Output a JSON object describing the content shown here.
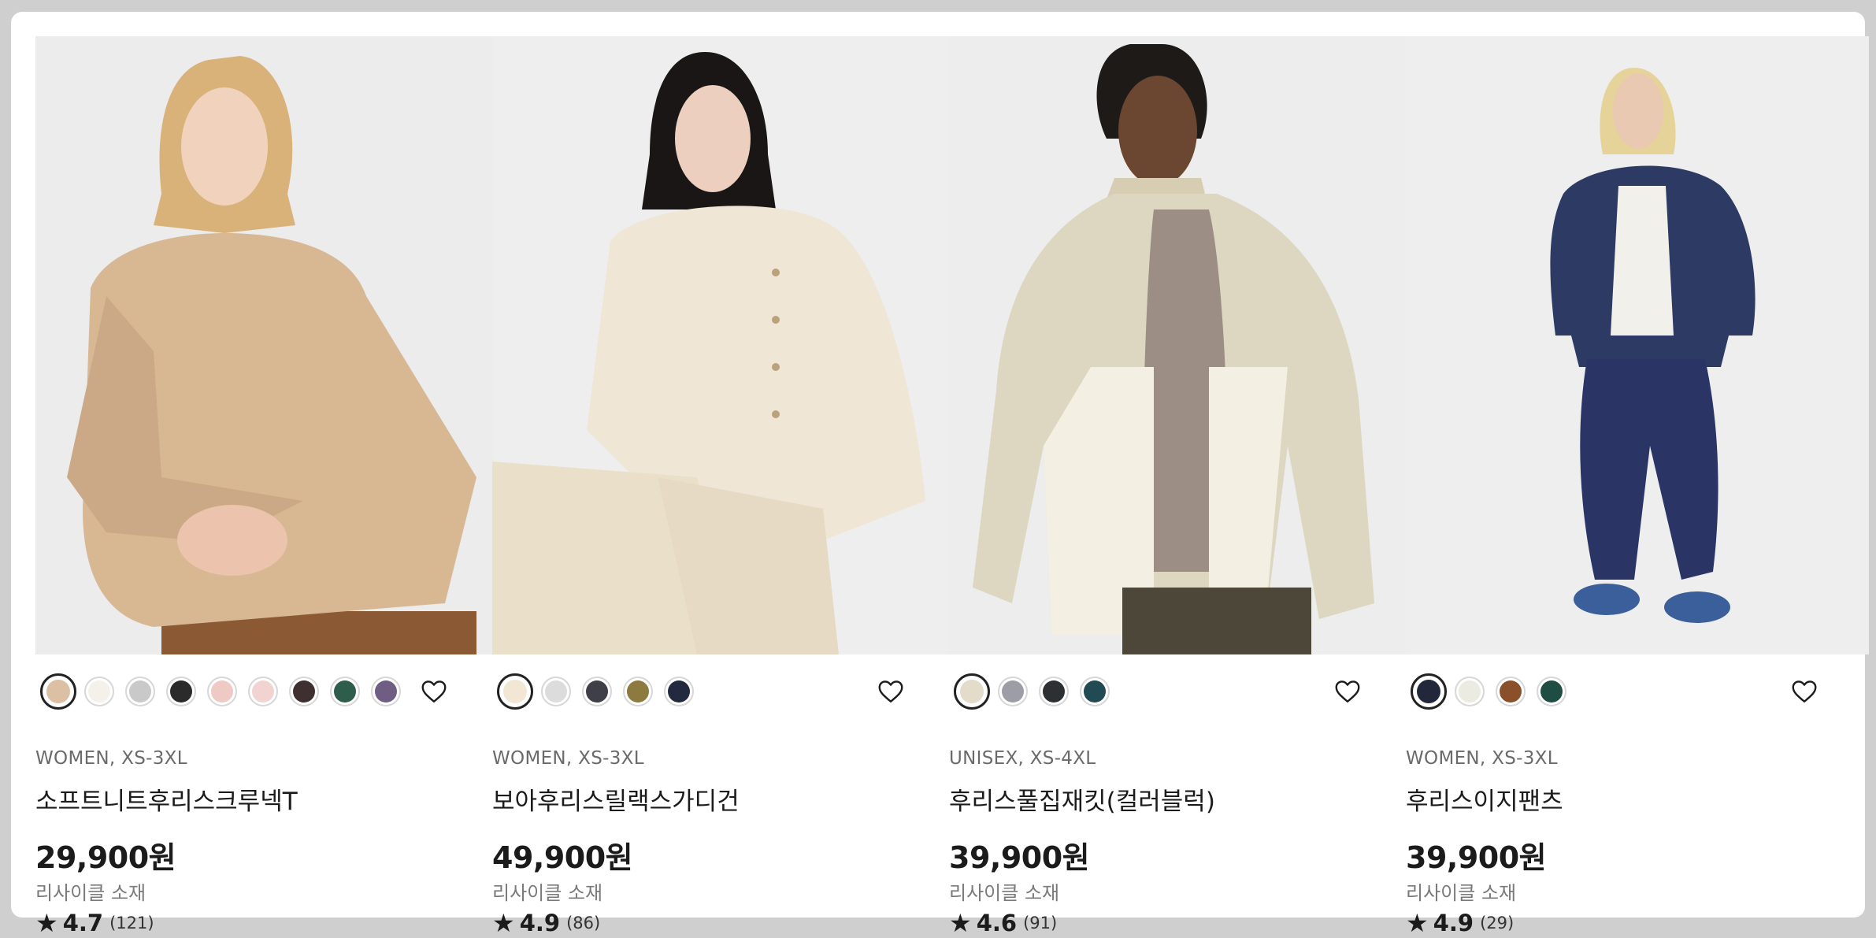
{
  "products": [
    {
      "meta": "WOMEN, XS-3XL",
      "name": "소프트니트후리스크루넥T",
      "price": "29,900원",
      "material": "리사이클 소재",
      "rating": "4.7",
      "reviews": "(121)",
      "swatches": [
        "#dcc0a4",
        "#f3f1ea",
        "#c9c9c9",
        "#2b2b2b",
        "#efc9c4",
        "#f1d4d2",
        "#3e2f30",
        "#2f5d4b",
        "#6f5d83"
      ],
      "selected_swatch": 0
    },
    {
      "meta": "WOMEN, XS-3XL",
      "name": "보아후리스릴랙스가디건",
      "price": "49,900원",
      "material": "리사이클 소재",
      "rating": "4.9",
      "reviews": "(86)",
      "swatches": [
        "#f1e7d4",
        "#dcdcdc",
        "#3f4047",
        "#8c7a3e",
        "#232a3f"
      ],
      "selected_swatch": 0
    },
    {
      "meta": "UNISEX, XS-4XL",
      "name": "후리스풀집재킷(컬러블럭)",
      "price": "39,900원",
      "material": "리사이클 소재",
      "rating": "4.6",
      "reviews": "(91)",
      "swatches": [
        "#e3dccb",
        "#9d9ea5",
        "#2d3033",
        "#214a52"
      ],
      "selected_swatch": 0
    },
    {
      "meta": "WOMEN, XS-3XL",
      "name": "후리스이지팬츠",
      "price": "39,900원",
      "material": "리사이클 소재",
      "rating": "4.9",
      "reviews": "(29)",
      "swatches": [
        "#22283a",
        "#ecebe1",
        "#8a5029",
        "#1f4d43"
      ],
      "selected_swatch": 0
    }
  ],
  "icons": {
    "favorite": "heart-outline-icon",
    "rating": "star-icon",
    "rating_glyph": "★"
  }
}
